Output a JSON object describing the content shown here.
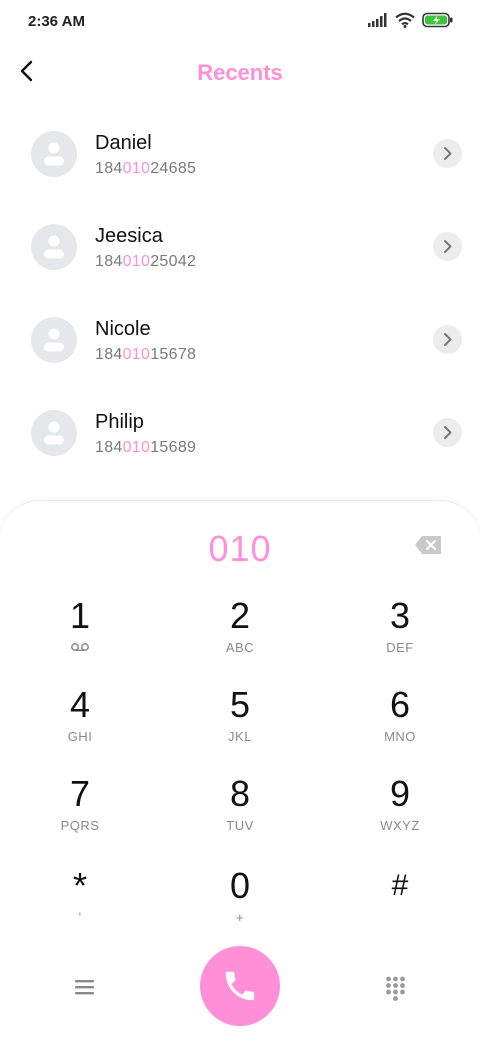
{
  "status": {
    "time": "2:36 AM"
  },
  "header": {
    "title": "Recents"
  },
  "contacts": [
    {
      "name": "Daniel",
      "pre": "184",
      "hl": "010",
      "post": "24685"
    },
    {
      "name": "Jeesica",
      "pre": "184",
      "hl": "010",
      "post": "25042"
    },
    {
      "name": "Nicole",
      "pre": "184",
      "hl": "010",
      "post": "15678"
    },
    {
      "name": "Philip",
      "pre": "184",
      "hl": "010",
      "post": "15689"
    }
  ],
  "dialer": {
    "input": "010",
    "keys": [
      {
        "digit": "1",
        "letters": ""
      },
      {
        "digit": "2",
        "letters": "ABC"
      },
      {
        "digit": "3",
        "letters": "DEF"
      },
      {
        "digit": "4",
        "letters": "GHI"
      },
      {
        "digit": "5",
        "letters": "JKL"
      },
      {
        "digit": "6",
        "letters": "MNO"
      },
      {
        "digit": "7",
        "letters": "PQRS"
      },
      {
        "digit": "8",
        "letters": "TUV"
      },
      {
        "digit": "9",
        "letters": "WXYZ"
      },
      {
        "digit": "*",
        "letters": ","
      },
      {
        "digit": "0",
        "letters": "+"
      },
      {
        "digit": "#",
        "letters": ""
      }
    ]
  },
  "icons": {
    "signal": "signal-icon",
    "wifi": "wifi-icon",
    "battery": "battery-charging-icon",
    "back": "back-arrow-icon",
    "chevron": "chevron-right-icon",
    "backspace": "backspace-icon",
    "voicemail": "voicemail-icon",
    "menu": "menu-icon",
    "call": "phone-icon",
    "dialpad": "dialpad-icon"
  },
  "colors": {
    "accent": "#ff8fd6",
    "battery": "#3cc43c"
  }
}
